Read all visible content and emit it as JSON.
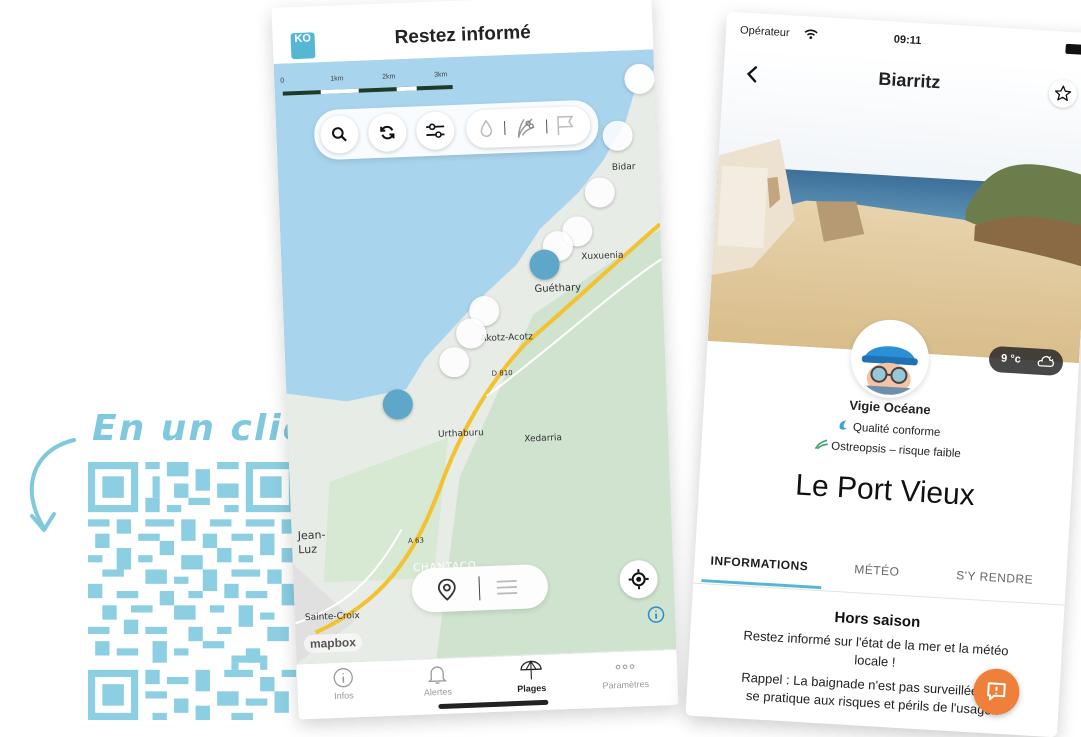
{
  "promo": {
    "tagline": "En un clic",
    "accent_color": "#7fc8dd"
  },
  "map_screen": {
    "logo_text": "KO",
    "title": "Restez informé",
    "scale_labels": [
      "0",
      "1km",
      "2km",
      "3km"
    ],
    "filter_icons": [
      "water-drop-icon",
      "algae-icon",
      "flag-icon"
    ],
    "place_labels": {
      "bidart": "Bidar",
      "xuxuenia": "Xuxuenia",
      "guethary": "Guéthary",
      "akotz": "Akotz-Acotz",
      "d810": "D 810",
      "urthaburu": "Urthaburu",
      "xedarria": "Xedarria",
      "saint_jean": "Jean-\nLuz",
      "a63": "A 63",
      "chantaco": "CHANTACO",
      "sainte_croix": "Sainte-Croix"
    },
    "attribution": "mapbox",
    "tabs": [
      {
        "label": "Infos",
        "icon": "info-icon"
      },
      {
        "label": "Alertes",
        "icon": "bell-icon"
      },
      {
        "label": "Plages",
        "icon": "umbrella-icon"
      },
      {
        "label": "Paramètres",
        "icon": "more-icon"
      }
    ],
    "active_tab": "Plages"
  },
  "beach_screen": {
    "carrier": "Opérateur",
    "time": "09:11",
    "title": "Biarritz",
    "temperature": "9 °c",
    "lifeguard": "Vigie Océane",
    "quality": "Qualité conforme",
    "ostreopsis": "Ostreopsis – risque faible",
    "beach_name": "Le Port Vieux",
    "tabs": [
      "INFORMATIONS",
      "MÉTÉO",
      "S'Y RENDRE"
    ],
    "active_tab": "INFORMATIONS",
    "section_title": "Hors saison",
    "info_line1": "Restez informé sur l'état de la mer et la météo",
    "info_line2": "locale !",
    "rappel_line1": "Rappel : La baignade n'est pas surveillée, elle",
    "rappel_line2": "se pratique aux risques et périls de l'usager.",
    "fab_color": "#ef7f3a"
  }
}
